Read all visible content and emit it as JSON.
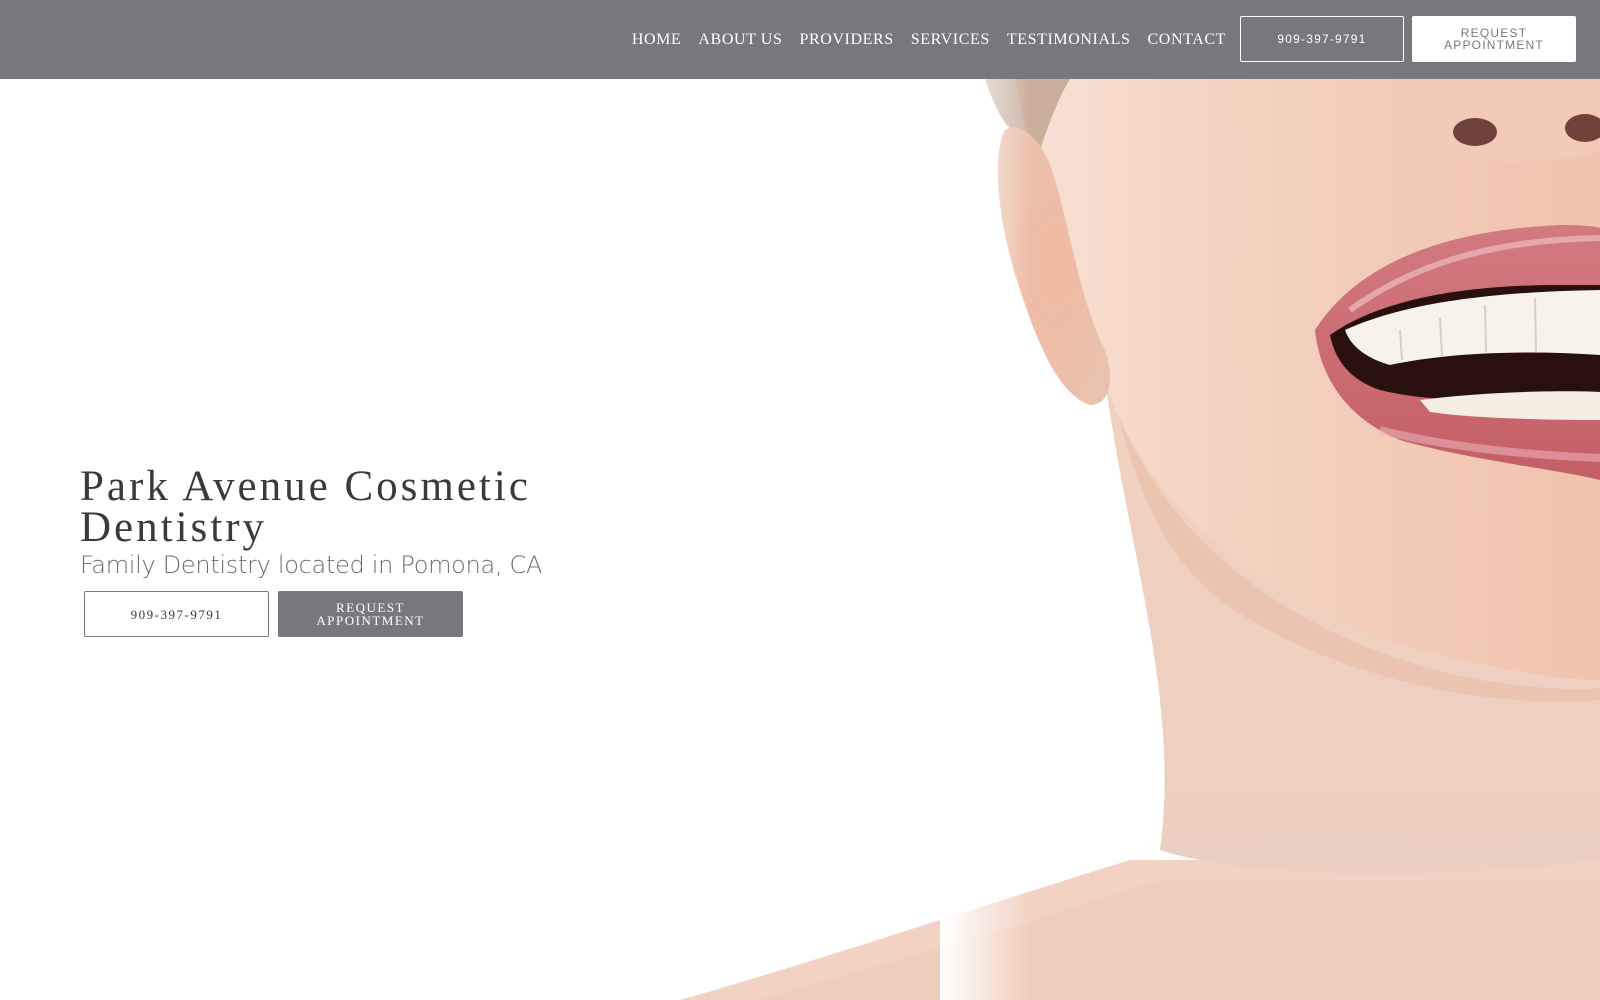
{
  "header": {
    "nav": [
      {
        "label": "HOME"
      },
      {
        "label": "ABOUT US"
      },
      {
        "label": "PROVIDERS"
      },
      {
        "label": "SERVICES"
      },
      {
        "label": "TESTIMONIALS"
      },
      {
        "label": "CONTACT"
      }
    ],
    "phone_label": "909-397-9791",
    "request_label": "REQUEST APPOINTMENT"
  },
  "hero": {
    "title": "Park Avenue Cosmetic Dentistry",
    "subtitle": "Family Dentistry located in Pomona, CA",
    "phone_label": "909-397-9791",
    "request_label": "REQUEST APPOINTMENT",
    "image": "smiling-woman-photo"
  },
  "colors": {
    "header_bg": "#77787d",
    "title_text": "#3a3a3c",
    "subtitle_text": "#6b6c70",
    "button_primary": "#77787d"
  }
}
